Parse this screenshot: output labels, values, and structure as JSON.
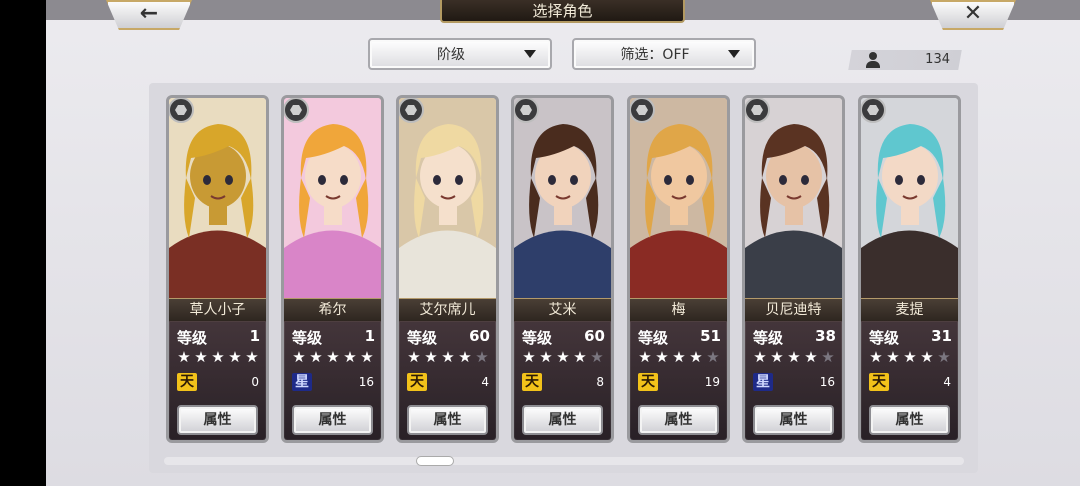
{
  "header": {
    "title": "选择角色",
    "back_glyph": "←",
    "close_glyph": "✕"
  },
  "toolbar": {
    "rank_dropdown": "阶级",
    "filter_dropdown": "筛选：OFF",
    "character_count": "134"
  },
  "characters": [
    {
      "name": "草人小子",
      "level_label": "等级",
      "level": "1",
      "stars": 5,
      "tier": "天",
      "tier_color": "gold",
      "count": "0",
      "attr_button": "属性",
      "palette": {
        "hair": "#d8a62a",
        "skin": "#c89a34",
        "outfit": "#7a2f24",
        "bg": "#e9dcc0"
      }
    },
    {
      "name": "希尔",
      "level_label": "等级",
      "level": "1",
      "stars": 5,
      "tier": "星",
      "tier_color": "blue",
      "count": "16",
      "attr_button": "属性",
      "palette": {
        "hair": "#f0a63a",
        "skin": "#f6dcc8",
        "outfit": "#d985c8",
        "bg": "#f3c9dd"
      }
    },
    {
      "name": "艾尔席儿",
      "level_label": "等级",
      "level": "60",
      "stars": 4,
      "tier": "天",
      "tier_color": "gold",
      "count": "4",
      "attr_button": "属性",
      "palette": {
        "hair": "#efd9a2",
        "skin": "#f5e0cc",
        "outfit": "#e8e4da",
        "bg": "#d9c7a8"
      }
    },
    {
      "name": "艾米",
      "level_label": "等级",
      "level": "60",
      "stars": 4,
      "tier": "天",
      "tier_color": "gold",
      "count": "8",
      "attr_button": "属性",
      "palette": {
        "hair": "#4a2c1e",
        "skin": "#f1d3bc",
        "outfit": "#2e3e6a",
        "bg": "#c9c3c7"
      }
    },
    {
      "name": "梅",
      "level_label": "等级",
      "level": "51",
      "stars": 4,
      "tier": "天",
      "tier_color": "gold",
      "count": "19",
      "attr_button": "属性",
      "palette": {
        "hair": "#e0a648",
        "skin": "#f0c8a0",
        "outfit": "#8a2b24",
        "bg": "#cdb8a2"
      }
    },
    {
      "name": "贝尼迪特",
      "level_label": "等级",
      "level": "38",
      "stars": 4,
      "tier": "星",
      "tier_color": "blue",
      "count": "16",
      "attr_button": "属性",
      "palette": {
        "hair": "#5a3322",
        "skin": "#e6c2a6",
        "outfit": "#3a3e48",
        "bg": "#d7d2d4"
      }
    },
    {
      "name": "麦提",
      "level_label": "等级",
      "level": "31",
      "stars": 4,
      "tier": "天",
      "tier_color": "gold",
      "count": "4",
      "attr_button": "属性",
      "palette": {
        "hair": "#5fc7cf",
        "skin": "#f3d9c6",
        "outfit": "#3a2e2c",
        "bg": "#d4d6da"
      }
    }
  ]
}
